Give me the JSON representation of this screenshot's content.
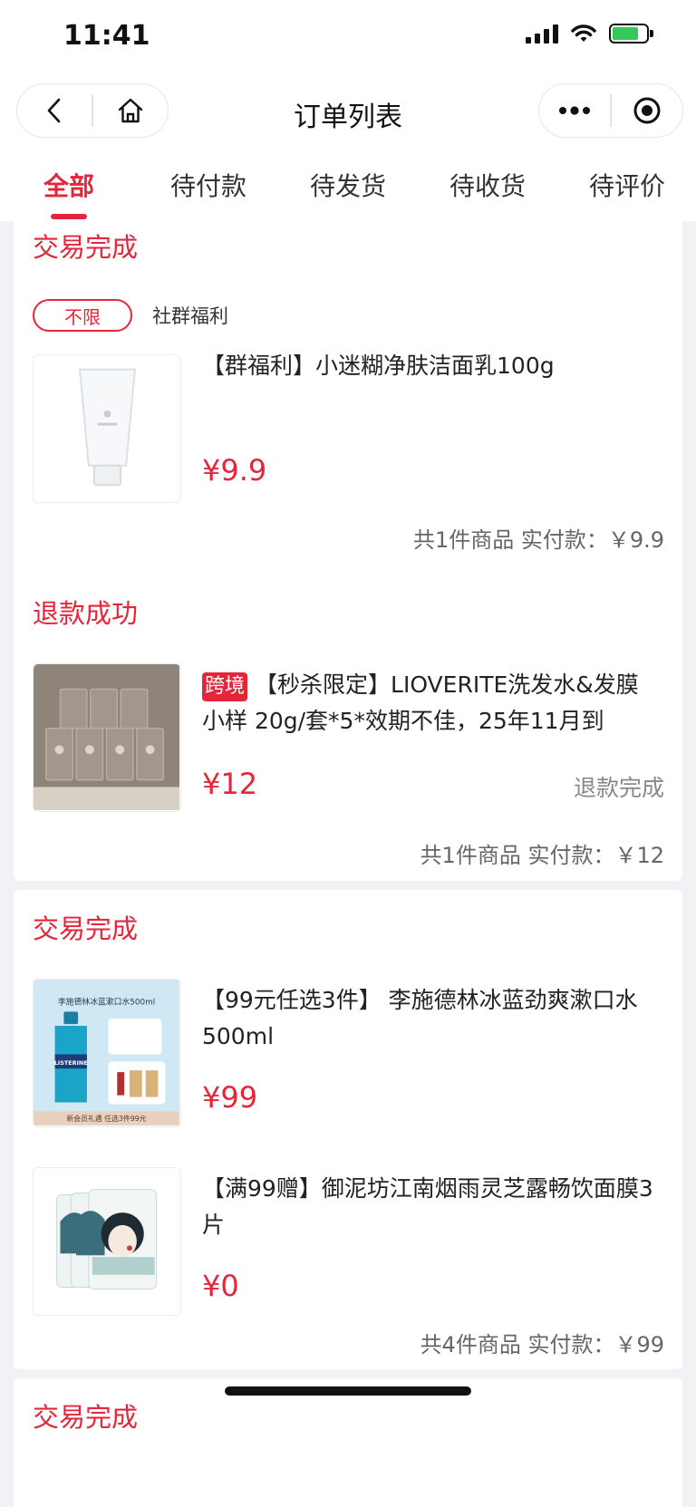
{
  "status_bar": {
    "time": "11:41"
  },
  "nav": {
    "title": "订单列表"
  },
  "tabs": [
    {
      "label": "全部",
      "active": true
    },
    {
      "label": "待付款",
      "active": false
    },
    {
      "label": "待发货",
      "active": false
    },
    {
      "label": "待收货",
      "active": false
    },
    {
      "label": "待评价",
      "active": false
    }
  ],
  "colors": {
    "accent": "#e5263a",
    "background": "#f1f2f6"
  },
  "orders": [
    {
      "status": "交易完成",
      "tag_pill": "不限",
      "tag_text": "社群福利",
      "items": [
        {
          "title": "【群福利】小迷糊净肤洁面乳100g",
          "price": "¥9.9",
          "thumb_icon": "cleanser-tube-image"
        }
      ],
      "summary": "共1件商品 实付款：￥9.9"
    },
    {
      "status": "退款成功",
      "items": [
        {
          "badge": "跨境",
          "title": "【秒杀限定】LIOVERITE洗发水&发膜小样 20g/套*5*效期不佳，25年11月到",
          "price": "¥12",
          "refund_label": "退款完成",
          "thumb_icon": "sample-packets-image"
        }
      ],
      "summary": "共1件商品 实付款：￥12"
    },
    {
      "status": "交易完成",
      "items": [
        {
          "title": "【99元任选3件】 李施德林冰蓝劲爽漱口水500ml",
          "price": "¥99",
          "thumb_icon": "mouthwash-image",
          "thumb_header": "李施德林冰蓝漱口水500ml",
          "thumb_brand": "LISTERINE",
          "thumb_footer": "新会员礼遇 任选3件99元"
        },
        {
          "title": "【满99赠】御泥坊江南烟雨灵芝露畅饮面膜3片",
          "price": "¥0",
          "thumb_icon": "face-mask-image"
        }
      ],
      "summary": "共4件商品 实付款：￥99"
    },
    {
      "status": "交易完成"
    }
  ]
}
